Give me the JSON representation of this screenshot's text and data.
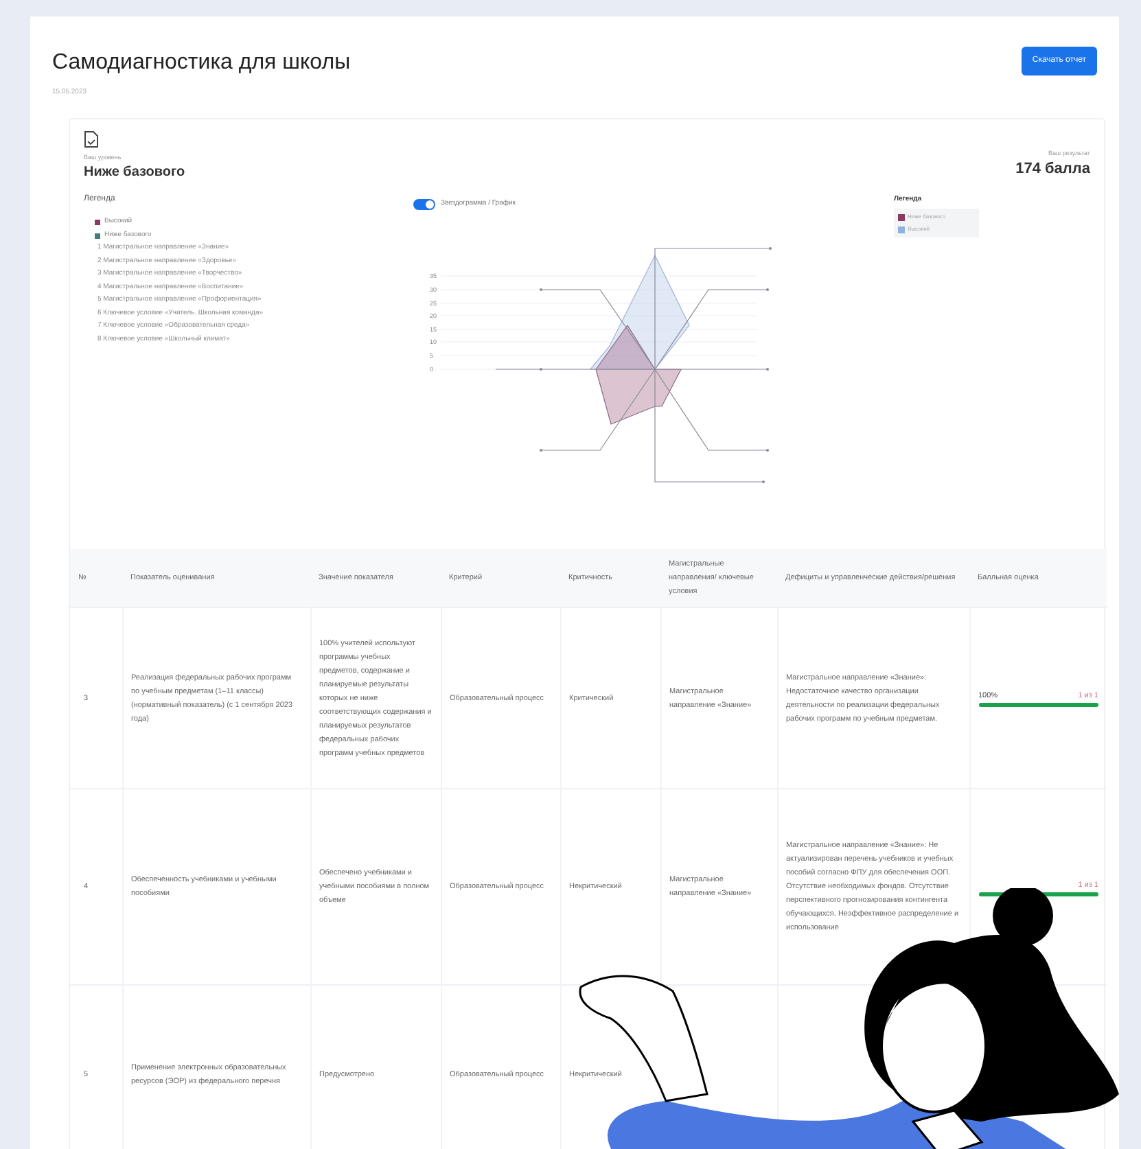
{
  "page": {
    "title": "Самодиагностика для школы",
    "date": "15.05.2023",
    "download_button": "Скачать отчет"
  },
  "summary": {
    "level_label": "Ваш уровень",
    "level": "Ниже базового",
    "score_label": "Ваш результат",
    "score": "174 балла"
  },
  "legend": {
    "title": "Легенда",
    "levels": [
      {
        "label": "Высокий",
        "color": "#8b3a62"
      },
      {
        "label": "Ниже базового",
        "color": "#3f7f7a"
      }
    ],
    "directions": [
      "1 Магистральное направление «Знание»",
      "2 Магистральное направление «Здоровье»",
      "3 Магистральное направление «Творчество»",
      "4 Магистральное направление «Воспитание»",
      "5 Магистральное направление «Профориентация»",
      "6 Ключевое условие «Учитель. Школьная команда»",
      "7 Ключевое условие «Образовательная среда»",
      "8 Ключевое условие «Школьный климат»"
    ]
  },
  "view_toggle": {
    "label": "Звездограмма / График",
    "on": true
  },
  "radar": {
    "ticks": [
      "35",
      "30",
      "25",
      "20",
      "15",
      "10",
      "5",
      "0"
    ]
  },
  "chart_legend": {
    "title": "Легенда",
    "items": [
      {
        "label": "Ниже базового",
        "color": "#8b3a62"
      },
      {
        "label": "Высокий",
        "color": "#8fb3e0"
      }
    ]
  },
  "table": {
    "columns": [
      "№",
      "Показатель оценивания",
      "Значение показателя",
      "Критерий",
      "Критичность",
      "Магистральные направления/ ключевые условия",
      "Дефициты и управленческие действия/решения",
      "Балльная оценка"
    ],
    "rows": [
      {
        "number": "3",
        "indicator": "Реализация федеральных рабочих программ по учебным предметам (1–11 классы) (нормативный показатель) (с 1 сентября 2023 года)",
        "value": "100% учителей используют программы учебных предметов, содержание и планируемые результаты которых не ниже соответствующих содержания и планируемых результатов федеральных рабочих программ учебных предметов",
        "criterion": "Образовательный процесс",
        "criticality": "Критический",
        "direction": "Магистральное направление «Знание»",
        "deficits": "Магистральное направление «Знание»: Недостаточное качество организации деятельности по реализации федеральных рабочих программ по учебным предметам.",
        "score_percent": "100%",
        "score": "1 из 1",
        "level": 1
      },
      {
        "number": "4",
        "indicator": "Обеспеченность учебниками и учебными пособиями",
        "value": "Обеспечено учебниками и учебными пособиями в полном объеме",
        "criterion": "Образовательный процесс",
        "criticality": "Некритический",
        "direction": "Магистральное направление «Знание»",
        "deficits": "Магистральное направление «Знание»: Не актуализирован перечень учебников и учебных пособий согласно ФПУ для обеспечения ООП. Отсутствие необходимых фондов. Отсутствие перспективного прогнозирования контингента обучающихся. Неэффективное распределение и использование",
        "score": "1 из 1",
        "level": 1
      },
      {
        "number": "5",
        "indicator": "Применение электронных образовательных ресурсов (ЭОР) из федерального перечня",
        "value": "Предусмотрено",
        "criterion": "Образовательный процесс",
        "criticality": "Некритический"
      }
    ]
  }
}
